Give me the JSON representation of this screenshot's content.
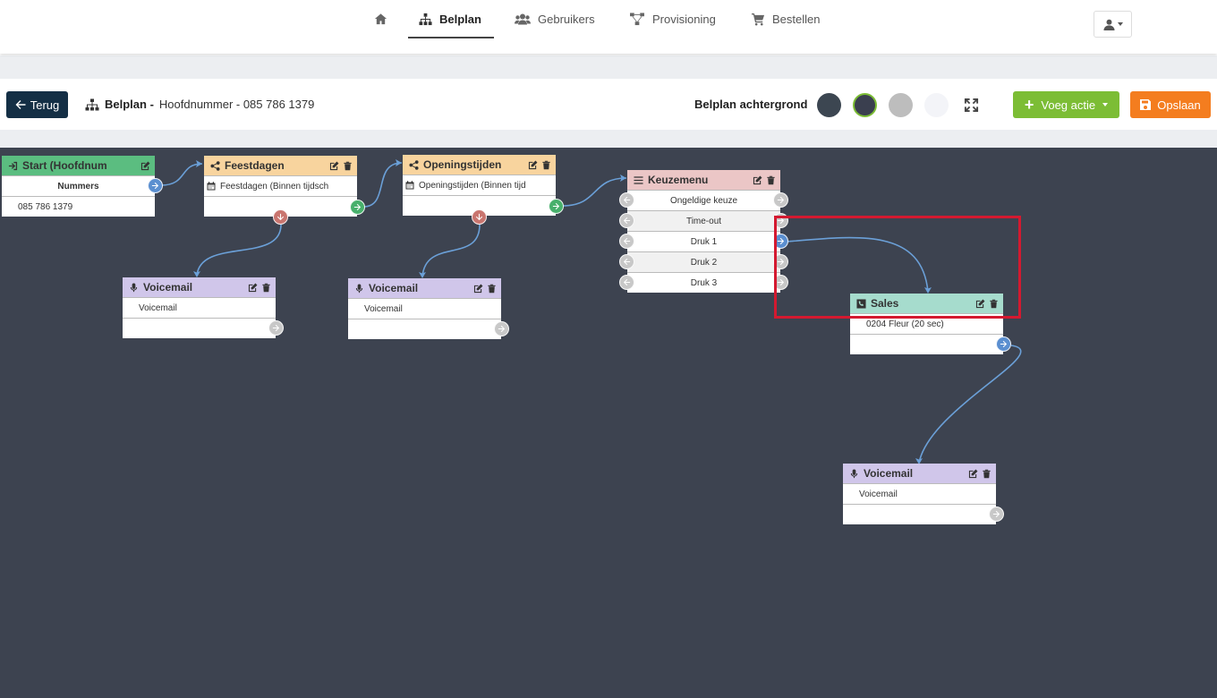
{
  "nav": {
    "items": [
      {
        "label": ""
      },
      {
        "label": "Belplan"
      },
      {
        "label": "Gebruikers"
      },
      {
        "label": "Provisioning"
      },
      {
        "label": "Bestellen"
      }
    ]
  },
  "toolbar": {
    "back_label": "Terug",
    "crumb_title": "Belplan -",
    "crumb_subtitle": "Hoofdnummer - 085 786 1379",
    "background_label": "Belplan achtergrond",
    "swatches": [
      "#3c4651",
      "#3a3f4f",
      "#bdbdbd",
      "#f3f4f8"
    ],
    "add_label": "Voeg actie",
    "save_label": "Opslaan"
  },
  "nodes": {
    "start": {
      "title": "Start (Hoofdnum",
      "row1": "Nummers",
      "row2": "085 786 1379"
    },
    "feestdagen": {
      "title": "Feestdagen",
      "row1": "Feestdagen (Binnen tijdsch"
    },
    "openingstijden": {
      "title": "Openingstijden",
      "row1": "Openingstijden (Binnen tijd"
    },
    "keuzemenu": {
      "title": "Keuzemenu",
      "options": [
        "Ongeldige keuze",
        "Time-out",
        "Druk 1",
        "Druk 2",
        "Druk 3"
      ]
    },
    "voicemail1": {
      "title": "Voicemail",
      "row1": "Voicemail"
    },
    "voicemail2": {
      "title": "Voicemail",
      "row1": "Voicemail"
    },
    "sales": {
      "title": "Sales",
      "row1": "0204 Fleur (20 sec)"
    },
    "voicemail3": {
      "title": "Voicemail",
      "row1": "Voicemail"
    }
  },
  "colors": {
    "primary_dark": "#142f45",
    "success": "#7cbd35",
    "warning": "#f47d1f",
    "canvas": "#3d4350",
    "highlight": "#d41930"
  }
}
